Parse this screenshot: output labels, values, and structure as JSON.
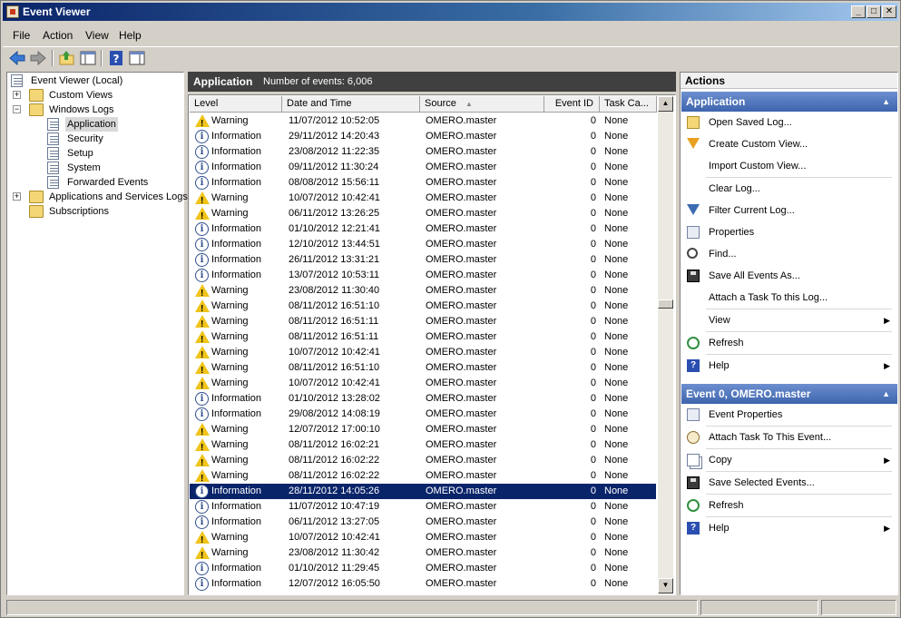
{
  "window": {
    "title": "Event Viewer"
  },
  "menu": [
    "File",
    "Action",
    "View",
    "Help"
  ],
  "tree": {
    "root": "Event Viewer (Local)",
    "custom_views": "Custom Views",
    "windows_logs": "Windows Logs",
    "logs": [
      "Application",
      "Security",
      "Setup",
      "System",
      "Forwarded Events"
    ],
    "app_services": "Applications and Services Logs",
    "subscriptions": "Subscriptions"
  },
  "center": {
    "log_name": "Application",
    "event_count": "Number of events: 6,006",
    "columns": [
      "Level",
      "Date and Time",
      "Source",
      "Event ID",
      "Task Ca..."
    ],
    "rows": [
      {
        "level": "Warning",
        "date": "11/07/2012 10:52:05",
        "source": "OMERO.master",
        "id": "0",
        "task": "None"
      },
      {
        "level": "Information",
        "date": "29/11/2012 14:20:43",
        "source": "OMERO.master",
        "id": "0",
        "task": "None"
      },
      {
        "level": "Information",
        "date": "23/08/2012 11:22:35",
        "source": "OMERO.master",
        "id": "0",
        "task": "None"
      },
      {
        "level": "Information",
        "date": "09/11/2012 11:30:24",
        "source": "OMERO.master",
        "id": "0",
        "task": "None"
      },
      {
        "level": "Information",
        "date": "08/08/2012 15:56:11",
        "source": "OMERO.master",
        "id": "0",
        "task": "None"
      },
      {
        "level": "Warning",
        "date": "10/07/2012 10:42:41",
        "source": "OMERO.master",
        "id": "0",
        "task": "None"
      },
      {
        "level": "Warning",
        "date": "06/11/2012 13:26:25",
        "source": "OMERO.master",
        "id": "0",
        "task": "None"
      },
      {
        "level": "Information",
        "date": "01/10/2012 12:21:41",
        "source": "OMERO.master",
        "id": "0",
        "task": "None"
      },
      {
        "level": "Information",
        "date": "12/10/2012 13:44:51",
        "source": "OMERO.master",
        "id": "0",
        "task": "None"
      },
      {
        "level": "Information",
        "date": "26/11/2012 13:31:21",
        "source": "OMERO.master",
        "id": "0",
        "task": "None"
      },
      {
        "level": "Information",
        "date": "13/07/2012 10:53:11",
        "source": "OMERO.master",
        "id": "0",
        "task": "None"
      },
      {
        "level": "Warning",
        "date": "23/08/2012 11:30:40",
        "source": "OMERO.master",
        "id": "0",
        "task": "None"
      },
      {
        "level": "Warning",
        "date": "08/11/2012 16:51:10",
        "source": "OMERO.master",
        "id": "0",
        "task": "None"
      },
      {
        "level": "Warning",
        "date": "08/11/2012 16:51:11",
        "source": "OMERO.master",
        "id": "0",
        "task": "None"
      },
      {
        "level": "Warning",
        "date": "08/11/2012 16:51:11",
        "source": "OMERO.master",
        "id": "0",
        "task": "None"
      },
      {
        "level": "Warning",
        "date": "10/07/2012 10:42:41",
        "source": "OMERO.master",
        "id": "0",
        "task": "None"
      },
      {
        "level": "Warning",
        "date": "08/11/2012 16:51:10",
        "source": "OMERO.master",
        "id": "0",
        "task": "None"
      },
      {
        "level": "Warning",
        "date": "10/07/2012 10:42:41",
        "source": "OMERO.master",
        "id": "0",
        "task": "None"
      },
      {
        "level": "Information",
        "date": "01/10/2012 13:28:02",
        "source": "OMERO.master",
        "id": "0",
        "task": "None"
      },
      {
        "level": "Information",
        "date": "29/08/2012 14:08:19",
        "source": "OMERO.master",
        "id": "0",
        "task": "None"
      },
      {
        "level": "Warning",
        "date": "12/07/2012 17:00:10",
        "source": "OMERO.master",
        "id": "0",
        "task": "None"
      },
      {
        "level": "Warning",
        "date": "08/11/2012 16:02:21",
        "source": "OMERO.master",
        "id": "0",
        "task": "None"
      },
      {
        "level": "Warning",
        "date": "08/11/2012 16:02:22",
        "source": "OMERO.master",
        "id": "0",
        "task": "None"
      },
      {
        "level": "Warning",
        "date": "08/11/2012 16:02:22",
        "source": "OMERO.master",
        "id": "0",
        "task": "None"
      },
      {
        "level": "Information",
        "date": "28/11/2012 14:05:26",
        "source": "OMERO.master",
        "id": "0",
        "task": "None",
        "selected": true
      },
      {
        "level": "Information",
        "date": "11/07/2012 10:47:19",
        "source": "OMERO.master",
        "id": "0",
        "task": "None"
      },
      {
        "level": "Information",
        "date": "06/11/2012 13:27:05",
        "source": "OMERO.master",
        "id": "0",
        "task": "None"
      },
      {
        "level": "Warning",
        "date": "10/07/2012 10:42:41",
        "source": "OMERO.master",
        "id": "0",
        "task": "None"
      },
      {
        "level": "Warning",
        "date": "23/08/2012 11:30:42",
        "source": "OMERO.master",
        "id": "0",
        "task": "None"
      },
      {
        "level": "Information",
        "date": "01/10/2012 11:29:45",
        "source": "OMERO.master",
        "id": "0",
        "task": "None"
      },
      {
        "level": "Information",
        "date": "12/07/2012 16:05:50",
        "source": "OMERO.master",
        "id": "0",
        "task": "None"
      }
    ]
  },
  "actions": {
    "title": "Actions",
    "section1": {
      "title": "Application",
      "items": [
        {
          "label": "Open Saved Log...",
          "icon": "folder-open-icon"
        },
        {
          "label": "Create Custom View...",
          "icon": "funnel-star-icon"
        },
        {
          "label": "Import Custom View...",
          "icon": ""
        },
        {
          "label": "Clear Log...",
          "icon": ""
        },
        {
          "label": "Filter Current Log...",
          "icon": "funnel-icon"
        },
        {
          "label": "Properties",
          "icon": "properties-icon"
        },
        {
          "label": "Find...",
          "icon": "binoculars-icon"
        },
        {
          "label": "Save All Events As...",
          "icon": "save-icon"
        },
        {
          "label": "Attach a Task To this Log...",
          "icon": ""
        },
        {
          "label": "View",
          "icon": "",
          "submenu": true
        },
        {
          "label": "Refresh",
          "icon": "refresh-icon"
        },
        {
          "label": "Help",
          "icon": "help-icon",
          "submenu": true
        }
      ]
    },
    "section2": {
      "title": "Event 0, OMERO.master",
      "items": [
        {
          "label": "Event Properties",
          "icon": "properties-icon"
        },
        {
          "label": "Attach Task To This Event...",
          "icon": "task-clock-icon"
        },
        {
          "label": "Copy",
          "icon": "copy-icon",
          "submenu": true
        },
        {
          "label": "Save Selected Events...",
          "icon": "save-icon"
        },
        {
          "label": "Refresh",
          "icon": "refresh-icon"
        },
        {
          "label": "Help",
          "icon": "help-icon",
          "submenu": true
        }
      ]
    }
  }
}
